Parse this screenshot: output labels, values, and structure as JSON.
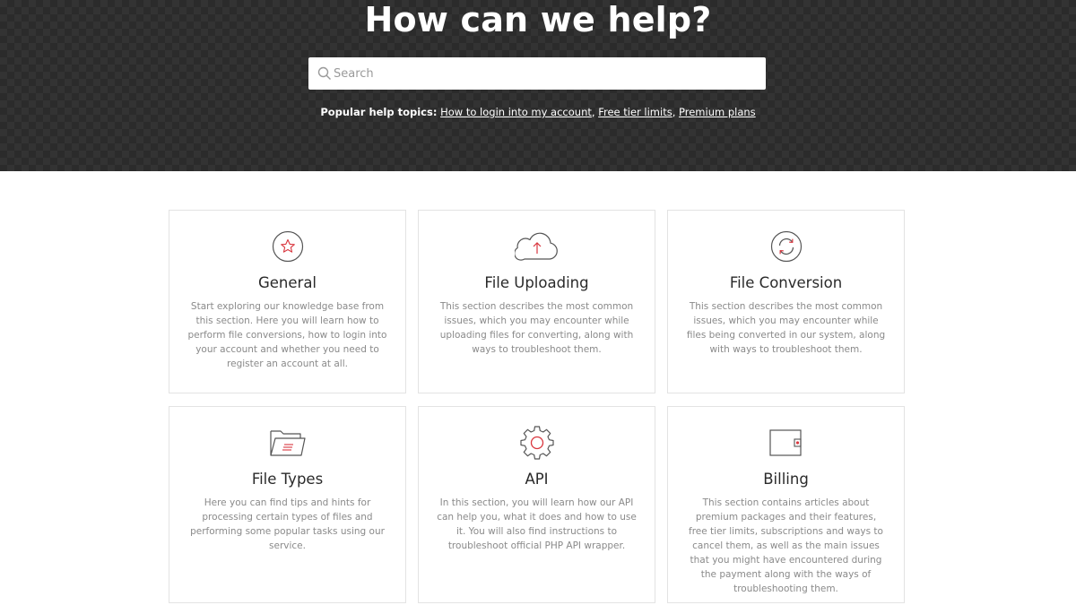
{
  "hero": {
    "title": "How can we help?",
    "search_placeholder": "Search",
    "popular_label": "Popular help topics:",
    "popular_links": [
      "How to login into my account",
      "Free tier limits",
      "Premium plans"
    ]
  },
  "cards": [
    {
      "icon": "star-icon",
      "title": "General",
      "description": "Start exploring our knowledge base from this section. Here you will learn how to perform file conversions, how to login into your account and whether you need to register an account at all."
    },
    {
      "icon": "cloud-upload-icon",
      "title": "File Uploading",
      "description": "This section describes the most common issues, which you may encounter while uploading files for converting, along with ways to troubleshoot them."
    },
    {
      "icon": "refresh-icon",
      "title": "File Conversion",
      "description": "This section describes the most common issues, which you may encounter while files being converted in our system, along with ways to troubleshoot them."
    },
    {
      "icon": "folder-icon",
      "title": "File Types",
      "description": "Here you can find tips and hints for processing certain types of files and performing some popular tasks using our service."
    },
    {
      "icon": "gear-icon",
      "title": "API",
      "description": "In this section, you will learn how our API can help you, what it does and how to use it. You will also find instructions to troubleshoot official PHP API wrapper."
    },
    {
      "icon": "wallet-icon",
      "title": "Billing",
      "description": "This section contains articles about premium packages and their features, free tier limits, subscriptions and ways to cancel them, as well as the main issues that you might have encountered during the payment along with the ways of troubleshooting them."
    }
  ],
  "colors": {
    "accent": "#d9363e",
    "icon_stroke": "#555555",
    "hero_bg": "#333333"
  }
}
